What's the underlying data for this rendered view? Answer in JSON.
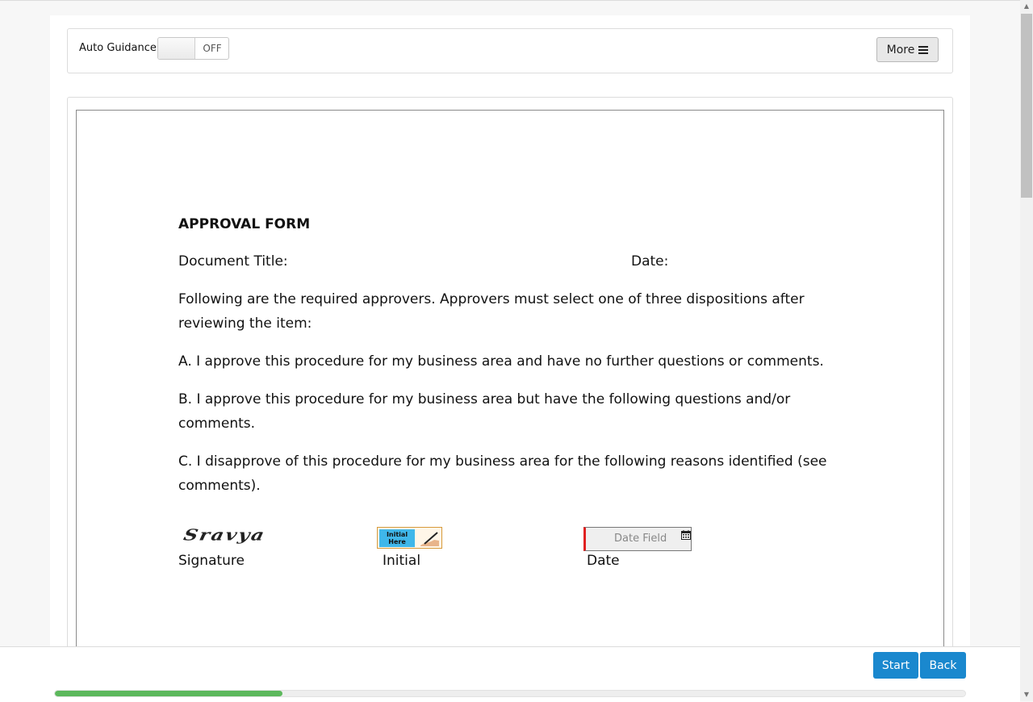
{
  "toolbar": {
    "auto_guidance_label": "Auto Guidance",
    "toggle_state": "OFF",
    "more_label": "More"
  },
  "document": {
    "title": "APPROVAL FORM",
    "doc_title_label": "Document Title:",
    "date_label": "Date:",
    "intro": "Following are the required approvers. Approvers must select one of three dispositions after reviewing the item:",
    "option_a": "A. I approve this procedure for my business area and have no further questions or comments.",
    "option_b": "B. I approve this procedure for my business area but have the following questions and/or comments.",
    "option_c": "C. I disapprove of this procedure for my business area for the following reasons identified (see comments).",
    "signature_value": "Sravya",
    "signature_label": "Signature",
    "initial_button_text": "Initial Here",
    "initial_label": "Initial",
    "date_field_placeholder": "Date Field",
    "date_field_label": "Date"
  },
  "footer": {
    "start_label": "Start",
    "back_label": "Back",
    "progress_percent": 25
  },
  "icons": {
    "more": "hamburger-icon",
    "calendar": "calendar-icon",
    "initial": "pen-icon"
  },
  "colors": {
    "primary_button": "#1a88ce",
    "progress": "#5cb85c",
    "required_marker": "#e02020",
    "initial_tag": "#3fb7ea"
  }
}
